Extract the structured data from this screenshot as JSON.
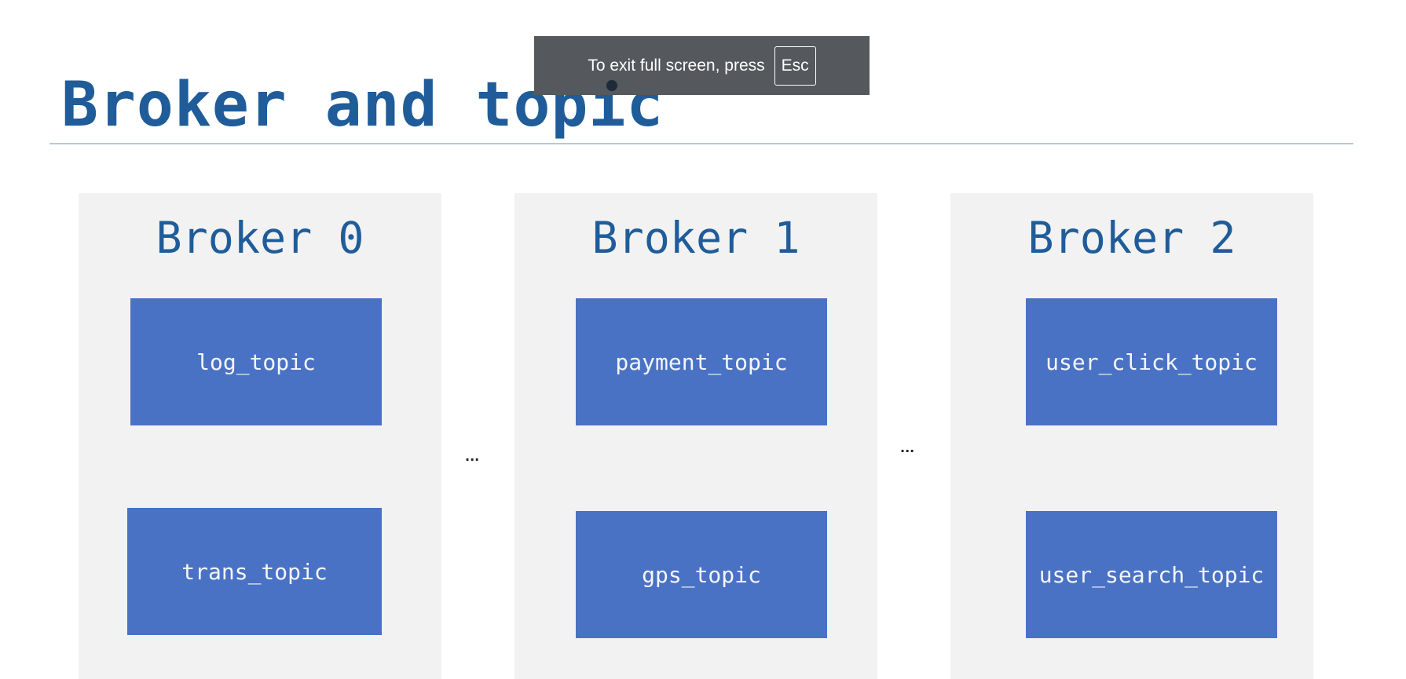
{
  "slide": {
    "title": "Broker and topic",
    "brokers": [
      {
        "name": "Broker 0",
        "topics": [
          "log_topic",
          "trans_topic"
        ]
      },
      {
        "name": "Broker 1",
        "topics": [
          "payment_topic",
          "gps_topic"
        ]
      },
      {
        "name": "Broker 2",
        "topics": [
          "user_click_topic",
          "user_search_topic"
        ]
      }
    ],
    "separators": [
      "...",
      "..."
    ]
  },
  "fullscreen_notice": {
    "message": "To exit full screen, press",
    "key": "Esc"
  },
  "colors": {
    "title": "#1f5c99",
    "panel_bg": "#f2f2f2",
    "topic_box": "#4a72c4",
    "overlay_bg": "#55585c"
  }
}
